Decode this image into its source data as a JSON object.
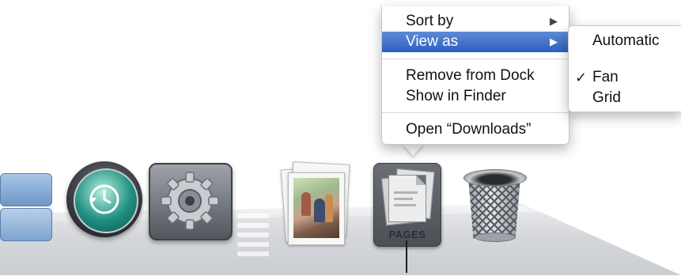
{
  "context_menu": {
    "items": [
      {
        "label": "Sort by",
        "arrow": "▶"
      },
      {
        "label": "View as",
        "arrow": "▶",
        "highlighted": true
      },
      {
        "label": "Remove from Dock"
      },
      {
        "label": "Show in Finder"
      },
      {
        "label": "Open “Downloads”"
      }
    ]
  },
  "view_as_submenu": {
    "items": [
      {
        "label": "Automatic",
        "checked": false
      },
      {
        "label": "Fan",
        "checked": true,
        "check_mark": "✓"
      },
      {
        "label": "Grid",
        "checked": false
      }
    ]
  },
  "dock": {
    "items": [
      {
        "name": "Stack",
        "icon": "stack-icon"
      },
      {
        "name": "Time Machine",
        "icon": "time-machine-icon"
      },
      {
        "name": "System Preferences",
        "icon": "system-preferences-icon"
      },
      {
        "name": "Photos stack",
        "icon": "photo-stack-icon"
      },
      {
        "name": "Downloads stack",
        "icon": "pages-document-icon",
        "label": "PAGES",
        "selected": true
      },
      {
        "name": "Trash",
        "icon": "trash-icon"
      }
    ]
  },
  "colors": {
    "highlight": "#2d5fc0",
    "menu_bg": "#ffffff",
    "shelf": "#d5d7db"
  }
}
